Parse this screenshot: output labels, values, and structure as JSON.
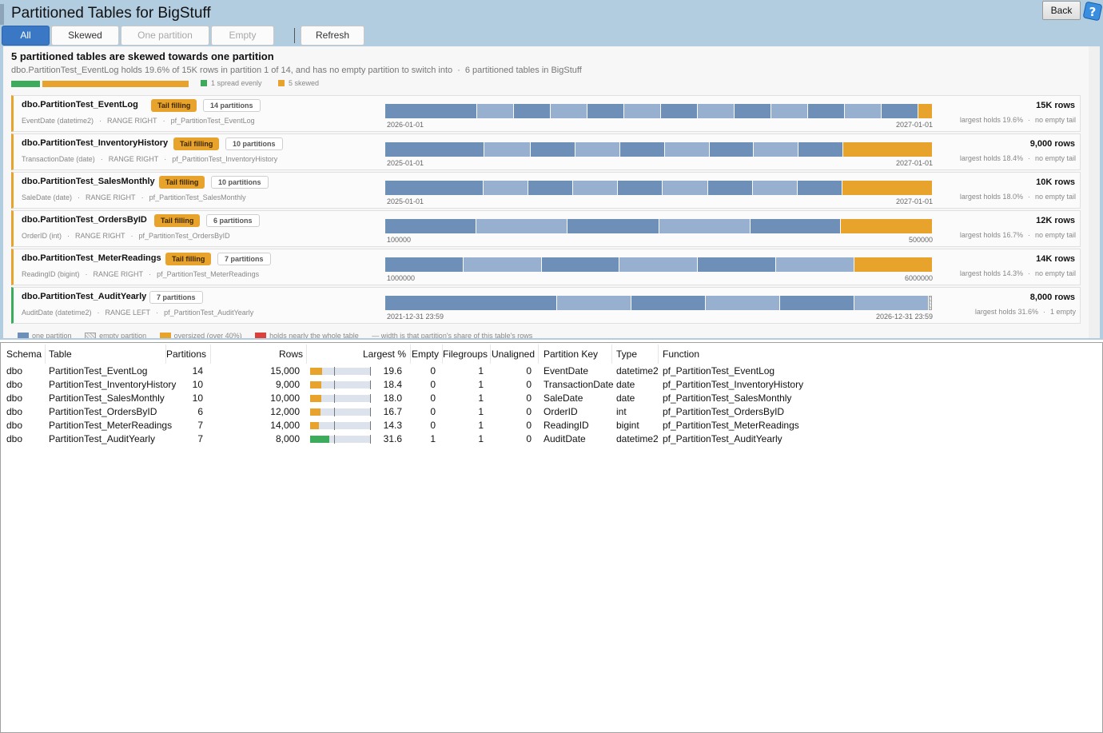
{
  "header": {
    "title": "Partitioned Tables for BigStuff",
    "back_label": "Back",
    "help_icon": "help-question-icon"
  },
  "tabs": [
    {
      "label": "All",
      "state": "active"
    },
    {
      "label": "Skewed",
      "state": "normal"
    },
    {
      "label": "One partition",
      "state": "disabled"
    },
    {
      "label": "Empty",
      "state": "disabled"
    },
    {
      "label": "Refresh",
      "state": "normal"
    }
  ],
  "summary": {
    "title": "5 partitioned tables are skewed towards one partition",
    "detail": "dbo.PartitionTest_EventLog holds 19.6% of 15K rows in partition 1 of 14, and has no empty partition to switch into",
    "detail_dot": "·",
    "count_text": "6 partitioned tables in BigStuff",
    "legend_even": "1 spread evenly",
    "legend_skewed": "5 skewed"
  },
  "cards": [
    {
      "name": "dbo.PartitionTest_EventLog",
      "badge": "Tail filling",
      "count": "14 partitions",
      "key": "EventDate (datetime2)",
      "range": "RANGE RIGHT",
      "func": "pf_PartitionTest_EventLog",
      "lo": "2026-01-01",
      "hi": "2027-01-01",
      "rows": "15K rows",
      "largest": "largest holds 19.6%",
      "empty": "no empty tail",
      "segments": [
        20,
        8,
        8,
        8,
        8,
        8,
        8,
        8,
        8,
        8,
        8,
        8,
        8,
        3
      ],
      "tail": "over"
    },
    {
      "name": "dbo.PartitionTest_InventoryHistory",
      "badge": "Tail filling",
      "count": "10 partitions",
      "key": "TransactionDate (date)",
      "range": "RANGE RIGHT",
      "func": "pf_PartitionTest_InventoryHistory",
      "lo": "2025-01-01",
      "hi": "2027-01-01",
      "rows": "9,000 rows",
      "largest": "largest holds 18.4%",
      "empty": "no empty tail",
      "segments": [
        18.4,
        8.7,
        8.3,
        8.3,
        8.3,
        8.3,
        8.3,
        8.3,
        8.3,
        16.5
      ],
      "tail": "over"
    },
    {
      "name": "dbo.PartitionTest_SalesMonthly",
      "badge": "Tail filling",
      "count": "10 partitions",
      "key": "SaleDate (date)",
      "range": "RANGE RIGHT",
      "func": "pf_PartitionTest_SalesMonthly",
      "lo": "2025-01-01",
      "hi": "2027-01-01",
      "rows": "10K rows",
      "largest": "largest holds 18.0%",
      "empty": "no empty tail",
      "segments": [
        18,
        8.2,
        8.2,
        8.2,
        8.2,
        8.2,
        8.2,
        8.2,
        8.2,
        16.4
      ],
      "tail": "over"
    },
    {
      "name": "dbo.PartitionTest_OrdersByID",
      "badge": "Tail filling",
      "count": "6 partitions",
      "key": "OrderID (int)",
      "range": "RANGE RIGHT",
      "func": "pf_PartitionTest_OrdersByID",
      "lo": "100000",
      "hi": "500000",
      "rows": "12K rows",
      "largest": "largest holds 16.7%",
      "empty": "no empty tail",
      "segments": [
        16.7,
        16.7,
        16.7,
        16.7,
        16.6,
        16.6
      ],
      "tail": "over"
    },
    {
      "name": "dbo.PartitionTest_MeterReadings",
      "badge": "Tail filling",
      "count": "7 partitions",
      "key": "ReadingID (bigint)",
      "range": "RANGE RIGHT",
      "func": "pf_PartitionTest_MeterReadings",
      "lo": "1000000",
      "hi": "6000000",
      "rows": "14K rows",
      "largest": "largest holds 14.3%",
      "empty": "no empty tail",
      "segments": [
        14.3,
        14.3,
        14.3,
        14.3,
        14.3,
        14.3,
        14.2
      ],
      "tail": "over"
    },
    {
      "name": "dbo.PartitionTest_AuditYearly",
      "badge": "",
      "count": "7 partitions",
      "key": "AuditDate (datetime2)",
      "range": "RANGE LEFT",
      "func": "pf_PartitionTest_AuditYearly",
      "lo": "2021-12-31 23:59",
      "hi": "2026-12-31 23:59",
      "rows": "8,000 rows",
      "largest": "largest holds 31.6%",
      "empty": "1 empty",
      "segments": [
        31.6,
        13.7,
        13.7,
        13.7,
        13.7,
        13.7,
        0.6
      ],
      "tail": "empty"
    }
  ],
  "legend": {
    "one": "one partition",
    "empty": "empty partition",
    "over": "oversized (over 40%)",
    "nearly": "holds nearly the whole table",
    "width": "width is that partition's share of this table's rows"
  },
  "grid": {
    "headers": [
      "Schema",
      "Table",
      "Partitions",
      "Rows",
      "Largest %",
      "Empty",
      "Filegroups",
      "Unaligned",
      "Partition Key",
      "Type",
      "Function"
    ],
    "rows": [
      {
        "schema": "dbo",
        "table": "PartitionTest_EventLog",
        "partitions": "14",
        "rows": "15,000",
        "largest": "19.6",
        "largest_val": 19.6,
        "empty": "0",
        "filegroups": "1",
        "unaligned": "0",
        "key": "EventDate",
        "type": "datetime2",
        "func": "pf_PartitionTest_EventLog",
        "bar": "o"
      },
      {
        "schema": "dbo",
        "table": "PartitionTest_InventoryHistory",
        "partitions": "10",
        "rows": "9,000",
        "largest": "18.4",
        "largest_val": 18.4,
        "empty": "0",
        "filegroups": "1",
        "unaligned": "0",
        "key": "TransactionDate",
        "type": "date",
        "func": "pf_PartitionTest_InventoryHistory",
        "bar": "o"
      },
      {
        "schema": "dbo",
        "table": "PartitionTest_SalesMonthly",
        "partitions": "10",
        "rows": "10,000",
        "largest": "18.0",
        "largest_val": 18.0,
        "empty": "0",
        "filegroups": "1",
        "unaligned": "0",
        "key": "SaleDate",
        "type": "date",
        "func": "pf_PartitionTest_SalesMonthly",
        "bar": "o"
      },
      {
        "schema": "dbo",
        "table": "PartitionTest_OrdersByID",
        "partitions": "6",
        "rows": "12,000",
        "largest": "16.7",
        "largest_val": 16.7,
        "empty": "0",
        "filegroups": "1",
        "unaligned": "0",
        "key": "OrderID",
        "type": "int",
        "func": "pf_PartitionTest_OrdersByID",
        "bar": "o"
      },
      {
        "schema": "dbo",
        "table": "PartitionTest_MeterReadings",
        "partitions": "7",
        "rows": "14,000",
        "largest": "14.3",
        "largest_val": 14.3,
        "empty": "0",
        "filegroups": "1",
        "unaligned": "0",
        "key": "ReadingID",
        "type": "bigint",
        "func": "pf_PartitionTest_MeterReadings",
        "bar": "o"
      },
      {
        "schema": "dbo",
        "table": "PartitionTest_AuditYearly",
        "partitions": "7",
        "rows": "8,000",
        "largest": "31.6",
        "largest_val": 31.6,
        "empty": "1",
        "filegroups": "1",
        "unaligned": "0",
        "key": "AuditDate",
        "type": "datetime2",
        "func": "pf_PartitionTest_AuditYearly",
        "bar": "g"
      }
    ]
  },
  "colors": {
    "accent": "#3a78c6",
    "skewed": "#e8a32c",
    "even": "#3dab5c",
    "part_dark": "#6e8fb8",
    "part_light": "#97b0cf",
    "nearly": "#d9413a"
  }
}
